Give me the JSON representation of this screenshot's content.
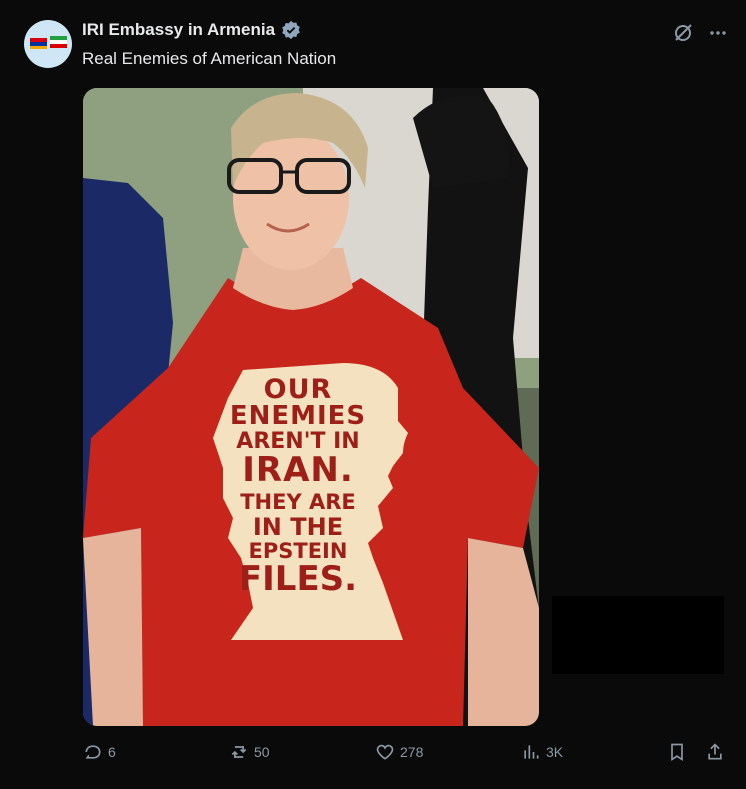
{
  "post": {
    "author_name": "IRI Embassy in Armenia",
    "text": "Real Enemies of American Nation",
    "shirt_text": [
      "OUR",
      "ENEMIES",
      "AREN'T IN",
      "IRAN.",
      "THEY ARE",
      "IN THE",
      "EPSTEIN",
      "FILES."
    ]
  },
  "icons": {
    "verified": "verified-badge-icon",
    "grok": "grok-icon",
    "more": "more-icon",
    "reply": "reply-icon",
    "repost": "repost-icon",
    "like": "like-icon",
    "views": "views-icon",
    "bookmark": "bookmark-icon",
    "share": "share-icon"
  },
  "stats": {
    "replies": "6",
    "reposts": "50",
    "likes": "278",
    "views": "3K"
  },
  "colors": {
    "background": "#0a0a0a",
    "text": "#e7e9ea",
    "muted": "#8b98a5",
    "verified": "#8fa6bd",
    "shirt": "#c8261c",
    "shirt_graphic": "#f3e1bf",
    "shirt_text": "#9e1f18"
  }
}
